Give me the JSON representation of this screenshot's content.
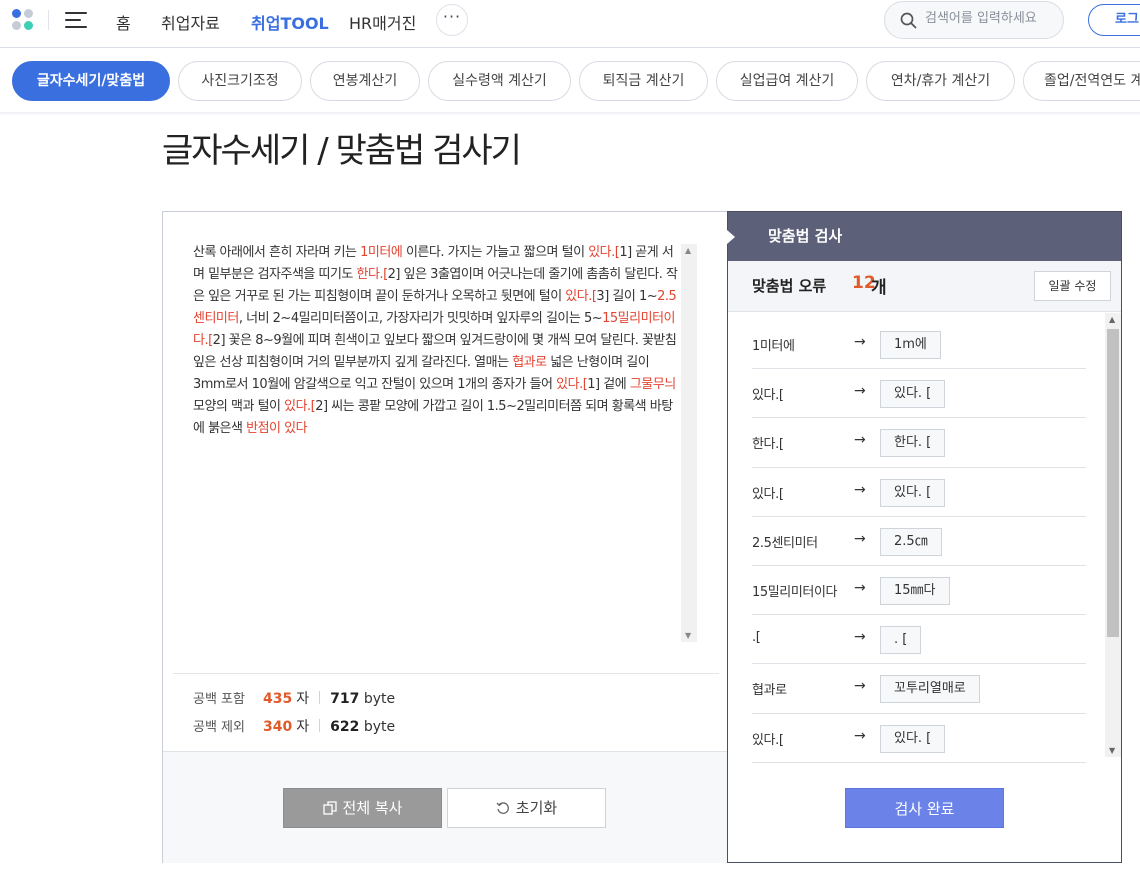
{
  "nav": {
    "logo": "logo",
    "menu_icon": "hamburger-menu-icon",
    "links": [
      "홈",
      "취업자료",
      "취업TOOL",
      "HR매거진"
    ],
    "active_link": "취업TOOL",
    "more_label": "···",
    "search_placeholder": "검색어를 입력하세요",
    "login_label": "로그"
  },
  "tabs": [
    {
      "label": "글자수세기/맞춤법",
      "active": true
    },
    {
      "label": "사진크기조정",
      "active": false
    },
    {
      "label": "연봉계산기",
      "active": false
    },
    {
      "label": "실수령액 계산기",
      "active": false
    },
    {
      "label": "퇴직금 계산기",
      "active": false
    },
    {
      "label": "실업급여 계산기",
      "active": false
    },
    {
      "label": "연차/휴가 계산기",
      "active": false
    },
    {
      "label": "졸업/전역연도 계",
      "active": false
    }
  ],
  "page_title": "글자수세기 / 맞춤법 검사기",
  "editor": {
    "segments": [
      {
        "t": "산록 아래에서 흔히 자라며 키는 "
      },
      {
        "t": "1미터에",
        "err": true
      },
      {
        "t": " 이른다. 가지는 가늘고 짧으며 털이 "
      },
      {
        "t": "있다.[",
        "err": true
      },
      {
        "t": "1] 곧게 서며 밑부분은 검자주색을 띠기도 "
      },
      {
        "t": "한다.[",
        "err": true
      },
      {
        "t": "2] 잎은 3출엽이며 어긋나는데 줄기에 촘촘히 달린다. 작은 잎은 거꾸로 된 가는 피침형이며 끝이 둔하거나 오목하고 뒷면에 털이 "
      },
      {
        "t": "있다.[",
        "err": true
      },
      {
        "t": "3] 길이 1~"
      },
      {
        "t": "2.5센티미터",
        "err": true
      },
      {
        "t": ", 너비 2~4밀리미터쯤이고, 가장자리가 밋밋하며 잎자루의 길이는 5~"
      },
      {
        "t": "15밀리미터이다.[",
        "err": true
      },
      {
        "t": "2] 꽃은 8~9월에 피며 흰색이고 잎보다 짧으며 잎겨드랑이에 몇 개씩 모여 달린다. 꽃받침잎은 선상 피침형이며 거의 밑부분까지 깊게 갈라진다. 열매는 "
      },
      {
        "t": "협과로",
        "err": true
      },
      {
        "t": " 넓은 난형이며 길이 3mm로서 10월에 암갈색으로 익고 잔털이 있으며 1개의 종자가 들어 "
      },
      {
        "t": "있다.[",
        "err": true
      },
      {
        "t": "1] 겉에 "
      },
      {
        "t": "그물무늬",
        "err": true
      },
      {
        "t": " 모양의 맥과 털이 "
      },
      {
        "t": "있다.[",
        "err": true
      },
      {
        "t": "2] 씨는 콩팥 모양에 가깝고 길이 1.5~2밀리미터쯤 되며 황록색 바탕에 붉은색 "
      },
      {
        "t": "반점이 있다",
        "err": true
      }
    ],
    "error_color": "#e3432f"
  },
  "counts": {
    "with_spaces": {
      "label": "공백 포함",
      "chars": "435",
      "char_unit": "자",
      "bytes": "717",
      "byte_unit": "byte"
    },
    "without_spaces": {
      "label": "공백 제외",
      "chars": "340",
      "char_unit": "자",
      "bytes": "622",
      "byte_unit": "byte"
    }
  },
  "buttons": {
    "copy": "전체 복사",
    "copy_icon": "copy-icon",
    "reset": "초기화",
    "reset_icon": "refresh-icon"
  },
  "spell": {
    "header": "맞춤법 검사",
    "error_label": "맞춤법 오류",
    "error_count": "12",
    "error_unit": "개",
    "fix_all": "일괄 수정",
    "suggestions": [
      {
        "orig": "1미터에",
        "fix": "1m에"
      },
      {
        "orig": "있다.[",
        "fix": "있다. ["
      },
      {
        "orig": "한다.[",
        "fix": "한다. ["
      },
      {
        "orig": "있다.[",
        "fix": "있다. ["
      },
      {
        "orig": "2.5센티미터",
        "fix": "2.5㎝"
      },
      {
        "orig": "15밀리미터이다",
        "fix": "15㎜다"
      },
      {
        "orig": ".[",
        "fix": ". ["
      },
      {
        "orig": "협과로",
        "fix": "꼬투리열매로"
      },
      {
        "orig": "있다.[",
        "fix": "있다. ["
      }
    ],
    "arrow": "→",
    "done": "검사 완료",
    "accent": "#6b83e8",
    "count_color": "#e05a2b"
  }
}
